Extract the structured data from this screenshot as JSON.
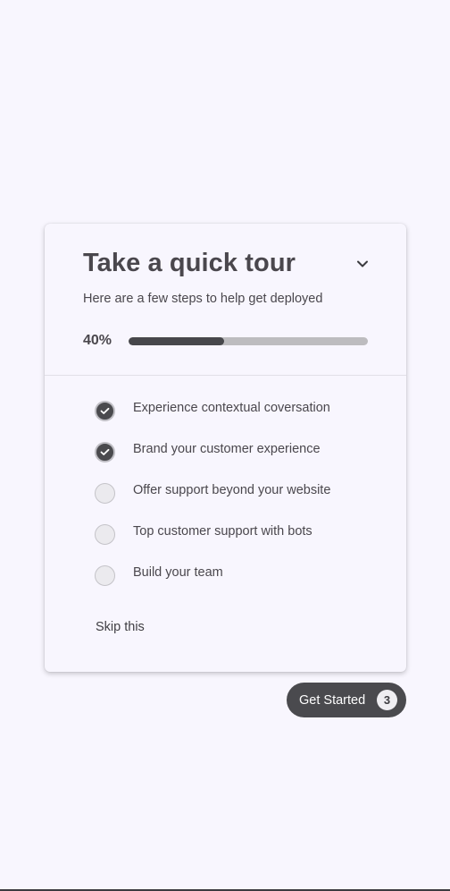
{
  "tour": {
    "title": "Take a quick tour",
    "subtitle": "Here are a few steps to help get deployed",
    "progress_label": "40%",
    "progress_value": 0.4,
    "collapse_icon": "chevron-down-icon",
    "steps": [
      {
        "label": "Experience contextual coversation",
        "completed": true
      },
      {
        "label": "Brand your customer experience",
        "completed": true
      },
      {
        "label": "Offer support beyond your website",
        "completed": false
      },
      {
        "label": "Top customer support with bots",
        "completed": false
      },
      {
        "label": "Build your team",
        "completed": false
      }
    ],
    "skip_label": "Skip this"
  },
  "launcher": {
    "label": "Get Started",
    "remaining_count": "3"
  },
  "colors": {
    "background": "#f8f6fe",
    "accent": "#4a4a4e",
    "progress_track": "#bdbcbf"
  }
}
